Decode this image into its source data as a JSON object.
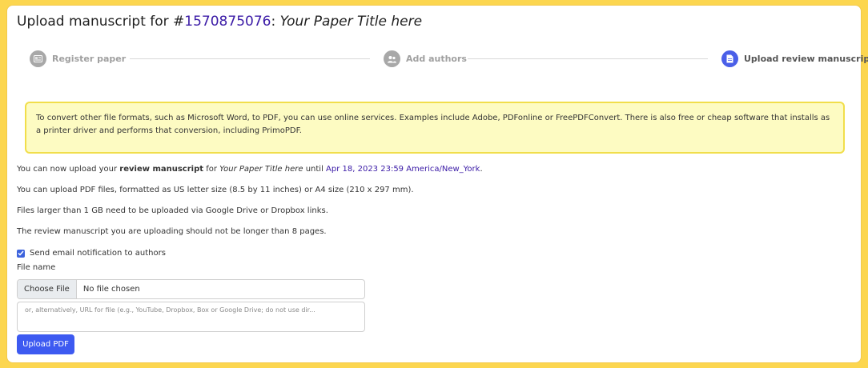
{
  "header": {
    "title_prefix": "Upload manuscript for #",
    "paper_id": "1570875076",
    "title_sep": ": ",
    "paper_title": "Your Paper Title here"
  },
  "steps": [
    {
      "label": "Register paper",
      "state": "done",
      "icon": "form-icon"
    },
    {
      "label": "Add authors",
      "state": "done",
      "icon": "people-icon"
    },
    {
      "label": "Upload review manuscript",
      "state": "active",
      "icon": "document-icon"
    }
  ],
  "alert": {
    "text": "To convert other file formats, such as Microsoft Word, to PDF, you can use online services. Examples include Adobe, PDFonline or FreePDFConvert. There is also free or cheap software that installs as a printer driver and performs that conversion, including PrimoPDF."
  },
  "info": {
    "p1_a": "You can now upload your ",
    "p1_b": "review manuscript",
    "p1_c": " for ",
    "p1_d": "Your Paper Title here",
    "p1_e": " until ",
    "p1_deadline": "Apr 18, 2023 23:59 America/New_York",
    "p1_f": ".",
    "p2": "You can upload PDF files, formatted as US letter size (8.5 by 11 inches) or A4 size (210 x 297 mm).",
    "p3": "Files larger than 1 GB need to be uploaded via Google Drive or Dropbox links.",
    "p4": "The review manuscript you are uploading should not be longer than 8 pages."
  },
  "form": {
    "notify_label": "Send email notification to authors",
    "notify_checked": true,
    "file_name_label": "File name",
    "choose_file_label": "Choose File",
    "no_file_text": "No file chosen",
    "url_placeholder": "or, alternatively, URL for file (e.g., YouTube, Dropbox, Box or Google Drive; do not use dir...",
    "upload_button": "Upload PDF"
  },
  "colors": {
    "background": "#fcd64f",
    "accent": "#3d5af1",
    "link": "#3a1aa6",
    "alert_bg": "#fdfbc2",
    "alert_border": "#f1de4b"
  }
}
